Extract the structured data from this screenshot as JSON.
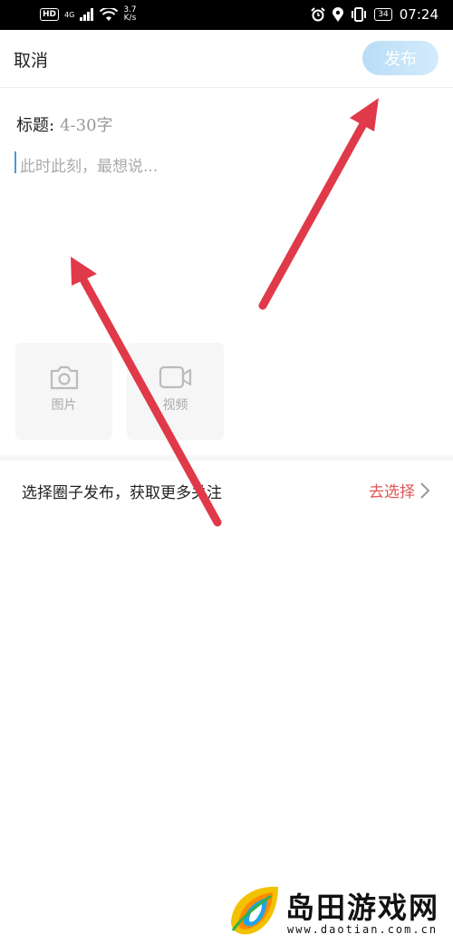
{
  "status_bar": {
    "hd": "HD",
    "network": "4G",
    "speed_value": "3.7",
    "speed_unit": "K/s",
    "battery": "34",
    "time": "07:24"
  },
  "header": {
    "cancel_label": "取消",
    "publish_label": "发布"
  },
  "editor": {
    "title_label": "标题:",
    "title_placeholder": "4-30字",
    "content_placeholder": "此时此刻，最想说..."
  },
  "media": {
    "photo_label": "图片",
    "video_label": "视频"
  },
  "circle": {
    "prompt": "选择圈子发布，获取更多关注",
    "action": "去选择"
  },
  "watermark": {
    "name": "岛田游戏网",
    "url": "www.daotian.com.cn"
  },
  "colors": {
    "publish_button": "#c4e3f8",
    "action_red": "#e05555",
    "arrow_red": "#e0394a",
    "cursor_blue": "#4a9ad8"
  }
}
